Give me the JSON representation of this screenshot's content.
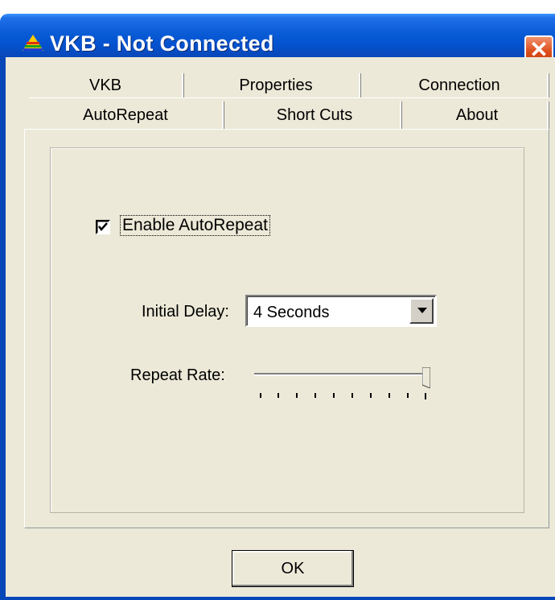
{
  "window": {
    "title": "VKB - Not Connected"
  },
  "tabs": {
    "row1": [
      "VKB",
      "Properties",
      "Connection"
    ],
    "row2": [
      "AutoRepeat",
      "Short Cuts",
      "About"
    ],
    "selected": "AutoRepeat"
  },
  "autorepeat": {
    "enable_label": "Enable AutoRepeat",
    "enable_checked": true,
    "initial_delay_label": "Initial Delay:",
    "initial_delay_value": "4 Seconds",
    "repeat_rate_label": "Repeat Rate:",
    "repeat_rate_fraction": 1.0
  },
  "buttons": {
    "ok": "OK"
  },
  "icons": {
    "app": "vkb-triangle-icon",
    "close": "close-icon",
    "dropdown": "chevron-down-icon",
    "check": "check-icon"
  },
  "colors": {
    "titlebar": "#0a5bd6",
    "close": "#dd4f1c",
    "dialog": "#ece9d8"
  }
}
